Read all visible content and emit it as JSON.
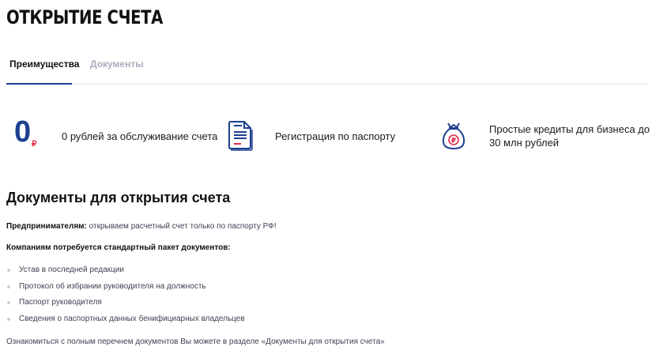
{
  "page": {
    "title": "ОТКРЫТИЕ СЧЕТА"
  },
  "tabs": [
    {
      "label": "Преимущества",
      "active": true
    },
    {
      "label": "Документы",
      "active": false
    }
  ],
  "features": [
    {
      "icon": "zero-ruble-icon",
      "icon_digit": "0",
      "icon_currency": "₽",
      "text": "0 рублей за обслуживание счета"
    },
    {
      "icon": "document-icon",
      "text": "Регистрация по паспорту"
    },
    {
      "icon": "money-bag-icon",
      "text": "Простые кредиты для бизнеса до 30 млн рублей"
    }
  ],
  "documents_section": {
    "title": "Документы для открытия счета",
    "entrepreneurs_label": "Предпринимателям:",
    "entrepreneurs_text": " открываем расчетный счет только по паспорту РФ!",
    "companies_text": "Компаниям потребуется стандартный пакет документов:",
    "items": [
      "Устав в последней редакции",
      "Протокол об избрании руководителя на должность",
      "Паспорт руководителя",
      "Сведения о паспортных данных бенифициарных владельцев"
    ],
    "footer_text": "Ознакомиться с полным перечнем документов Вы можете в разделе «Документы для открытия счета»"
  },
  "colors": {
    "brand_blue": "#1d3f8f",
    "accent_red": "#e02b4a",
    "inactive_tab": "#a6adba"
  }
}
